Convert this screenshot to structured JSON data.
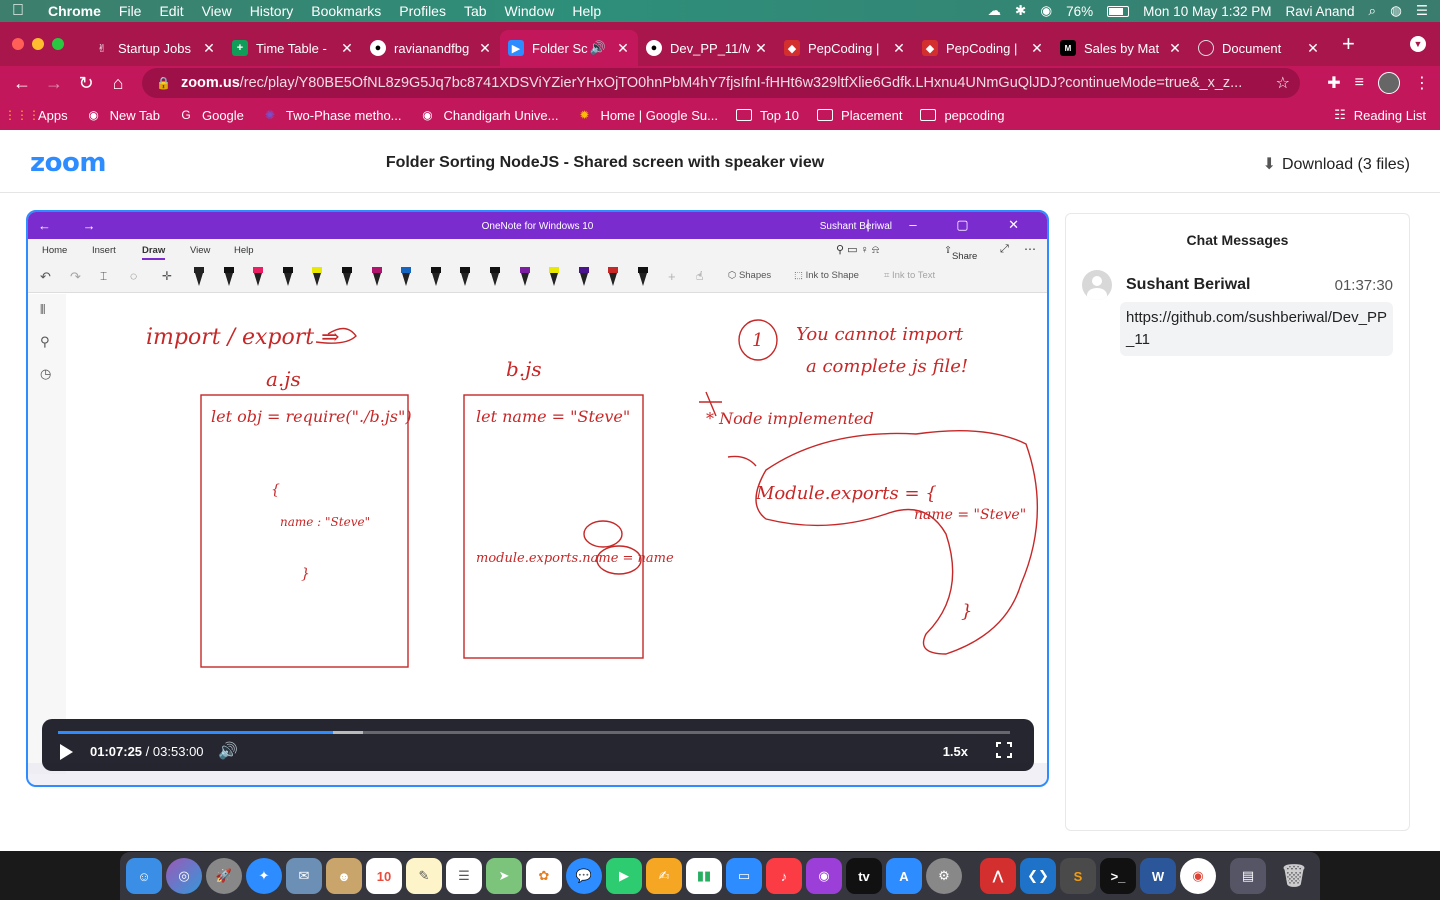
{
  "menubar": {
    "items": [
      "Chrome",
      "File",
      "Edit",
      "View",
      "History",
      "Bookmarks",
      "Profiles",
      "Tab",
      "Window",
      "Help"
    ],
    "battery": "76%",
    "datetime": "Mon 10 May  1:32 PM",
    "user": "Ravi Anand"
  },
  "tabs": [
    {
      "label": "Startup Jobs",
      "color": "#ffffff"
    },
    {
      "label": "Time Table -",
      "color": "#0f9d58"
    },
    {
      "label": "ravianandfbg",
      "color": "#000000"
    },
    {
      "label": "Folder Sc",
      "color": "#2d8cff"
    },
    {
      "label": "Dev_PP_11/M",
      "color": "#000000"
    },
    {
      "label": "PepCoding |",
      "color": "#d32f2f"
    },
    {
      "label": "PepCoding |",
      "color": "#d32f2f"
    },
    {
      "label": "Sales by Mat",
      "color": "#000000"
    },
    {
      "label": "Document",
      "color": "#cccccc"
    }
  ],
  "address": {
    "host": "zoom.us",
    "path": "/rec/play/Y80BE5OfNL8z9G5Jq7bc8741XDSViYZierYHxOjTO0hnPbM4hY7fjsIfnI-fHHt6w329ltfXlie6Gdfk.LHxnu4UNmGuQlJDJ?continueMode=true&_x_z..."
  },
  "bookmarks": [
    {
      "label": "Apps",
      "type": "apps"
    },
    {
      "label": "New Tab",
      "type": "site"
    },
    {
      "label": "Google",
      "type": "site"
    },
    {
      "label": "Two-Phase metho...",
      "type": "site"
    },
    {
      "label": "Chandigarh Unive...",
      "type": "site"
    },
    {
      "label": "Home | Google Su...",
      "type": "site"
    },
    {
      "label": "Top 10",
      "type": "folder"
    },
    {
      "label": "Placement",
      "type": "folder"
    },
    {
      "label": "pepcoding",
      "type": "folder"
    }
  ],
  "reading_list": "Reading List",
  "zoom": {
    "logo": "zoom",
    "title": "Folder Sorting NodeJS - Shared screen with speaker view",
    "download": "Download (3 files)"
  },
  "onenote": {
    "title": "OneNote for Windows 10",
    "user": "Sushant Beriwal",
    "tabs": [
      "Home",
      "Insert",
      "Draw",
      "View",
      "Help"
    ],
    "share": "Share",
    "shapes": "Shapes",
    "ink_to_shape": "Ink to Shape",
    "ink_to_text": "Ink to Text",
    "pen_colors": [
      "#222222",
      "#111111",
      "#e91e63",
      "#111111",
      "#e8e800",
      "#111111",
      "#b0156e",
      "#1565c0",
      "#111111",
      "#111111",
      "#111111",
      "#7b1fa2",
      "#e8e800",
      "#4a148c",
      "#c62828",
      "#111111"
    ]
  },
  "notes": {
    "heading": "import / export  ⇒",
    "file_a": "a.js",
    "file_b": "b.js",
    "a_line1": "let obj = require(\"./b.js\")",
    "a_obj": "{",
    "a_name": "name : \"Steve\"",
    "a_close": "}",
    "b_line1": "let name = \"Steve\"",
    "b_line2": "module.exports.name = name",
    "note1_a": "You cannot import",
    "note1_b": "a complete js file!",
    "note1_num": "1",
    "note2": "* Node implemented",
    "module_exports": "Module.exports = {",
    "module_name": "name = \"Steve\"",
    "module_close": "}"
  },
  "player": {
    "current": "01:07:25",
    "separator": "/",
    "total": "03:53:00",
    "speed": "1.5x",
    "progress": 0.289,
    "buffered": 0.32
  },
  "chat": {
    "title": "Chat Messages",
    "messages": [
      {
        "name": "Sushant Beriwal",
        "time": "01:37:30",
        "text": "https://github.com/sushberiwal/Dev_PP_11"
      }
    ]
  }
}
